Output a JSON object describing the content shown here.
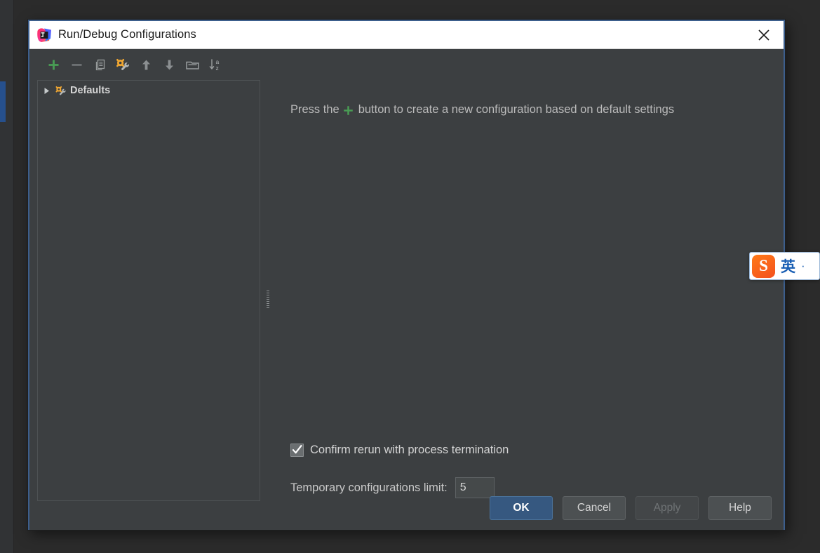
{
  "window": {
    "title": "Run/Debug Configurations",
    "app_icon": "intellij-idea-icon",
    "close_icon": "close-icon"
  },
  "toolbar": {
    "items": [
      {
        "name": "add-configuration-button",
        "icon": "plus-icon",
        "tooltip": "Add New Configuration"
      },
      {
        "name": "remove-configuration-button",
        "icon": "minus-icon",
        "tooltip": "Remove Configuration"
      },
      {
        "name": "copy-configuration-button",
        "icon": "copy-icon",
        "tooltip": "Copy Configuration"
      },
      {
        "name": "edit-defaults-button",
        "icon": "wrench-gear-icon",
        "tooltip": "Edit defaults"
      },
      {
        "name": "move-up-button",
        "icon": "arrow-up-icon",
        "tooltip": "Move Up"
      },
      {
        "name": "move-down-button",
        "icon": "arrow-down-icon",
        "tooltip": "Move Down"
      },
      {
        "name": "create-folder-button",
        "icon": "folder-icon",
        "tooltip": "Create New Folder"
      },
      {
        "name": "sort-configurations-button",
        "icon": "sort-az-icon",
        "tooltip": "Sort Configurations"
      }
    ]
  },
  "tree": {
    "nodes": [
      {
        "label": "Defaults",
        "expanded": false,
        "arrow_icon": "triangle-right-icon",
        "node_icon": "wrench-gear-icon"
      }
    ]
  },
  "main": {
    "hint_prefix": "Press the",
    "hint_icon": "plus-icon",
    "hint_suffix": "button to create a new configuration based on default settings",
    "confirm_rerun": {
      "label": "Confirm rerun with process termination",
      "checked": true,
      "check_icon": "checkmark-icon"
    },
    "temporary_limit": {
      "label": "Temporary configurations limit:",
      "value": "5",
      "placeholder": ""
    }
  },
  "footer": {
    "buttons": [
      {
        "label": "OK",
        "style": "primary",
        "enabled": true,
        "name": "ok-button"
      },
      {
        "label": "Cancel",
        "style": "normal",
        "enabled": true,
        "name": "cancel-button"
      },
      {
        "label": "Apply",
        "style": "disabled",
        "enabled": false,
        "name": "apply-button"
      },
      {
        "label": "Help",
        "style": "normal",
        "enabled": true,
        "name": "help-button"
      }
    ]
  },
  "ime_bar": {
    "logo_text": "S",
    "mode": "英",
    "extra": "·",
    "name": "sogou-ime-toolbar"
  },
  "colors": {
    "dialog_background": "#3c3f41",
    "dialog_border": "#3c5e8c",
    "titlebar_background": "#ffffff",
    "accent_primary": "#365880",
    "text_primary": "#d6d6d6",
    "plus_green": "#499c54",
    "ime_orange": "#f4511e",
    "ime_blue": "#1a5fb4"
  }
}
